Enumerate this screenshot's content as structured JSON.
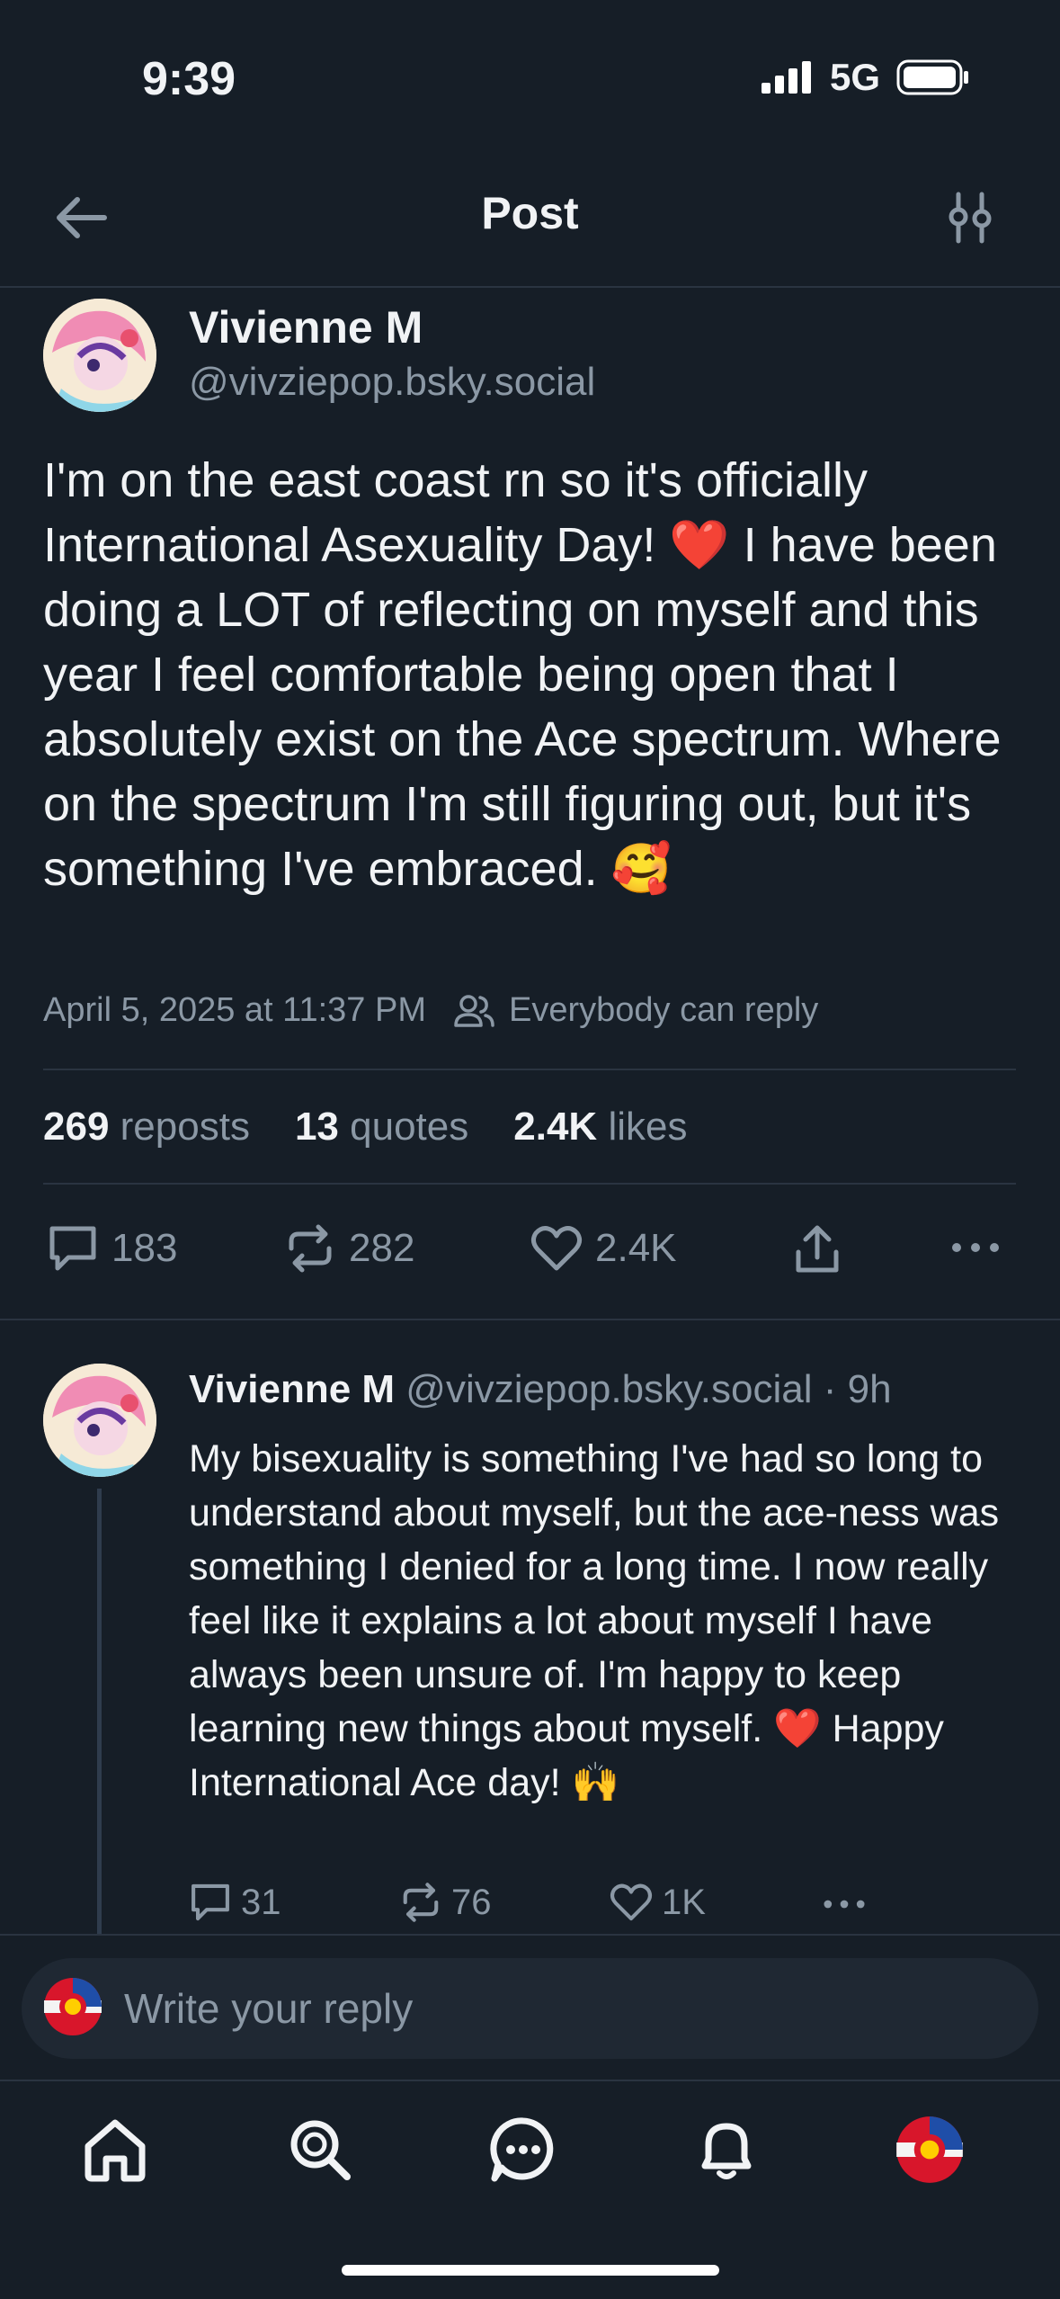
{
  "status_bar": {
    "time": "9:39",
    "network": "5G"
  },
  "header": {
    "title": "Post"
  },
  "post": {
    "author_name": "Vivienne M",
    "handle": "@vivziepop.bsky.social",
    "text": "I'm on the east coast rn so it's officially International Asexuality Day! ❤️ I have been doing a LOT of reflecting on myself and this year I feel comfortable being open that I absolutely exist on the Ace spectrum. Where on the spectrum I'm still figuring out, but it's something I've embraced. 🥰",
    "timestamp": "April 5, 2025 at 11:37 PM",
    "reply_permission": "Everybody can reply",
    "stats": {
      "reposts_count": "269",
      "reposts_label": "reposts",
      "quotes_count": "13",
      "quotes_label": "quotes",
      "likes_count": "2.4K",
      "likes_label": "likes"
    },
    "actions": {
      "replies": "183",
      "reposts": "282",
      "likes": "2.4K"
    }
  },
  "reply": {
    "author_name": "Vivienne M",
    "handle": "@vivziepop.bsky.social",
    "time": "· 9h",
    "text": "My bisexuality is something I've had so long to understand about myself, but the ace-ness was something I denied for a long time. I now really feel like it explains a lot about myself I have always been unsure of. I'm happy to keep learning new things about myself. ❤️ Happy International Ace day! 🙌",
    "actions": {
      "replies": "31",
      "reposts": "76",
      "likes": "1K"
    }
  },
  "composer": {
    "placeholder": "Write your reply"
  },
  "colors": {
    "background": "#161e27",
    "muted": "#8b98a5",
    "divider": "#2a3441"
  }
}
